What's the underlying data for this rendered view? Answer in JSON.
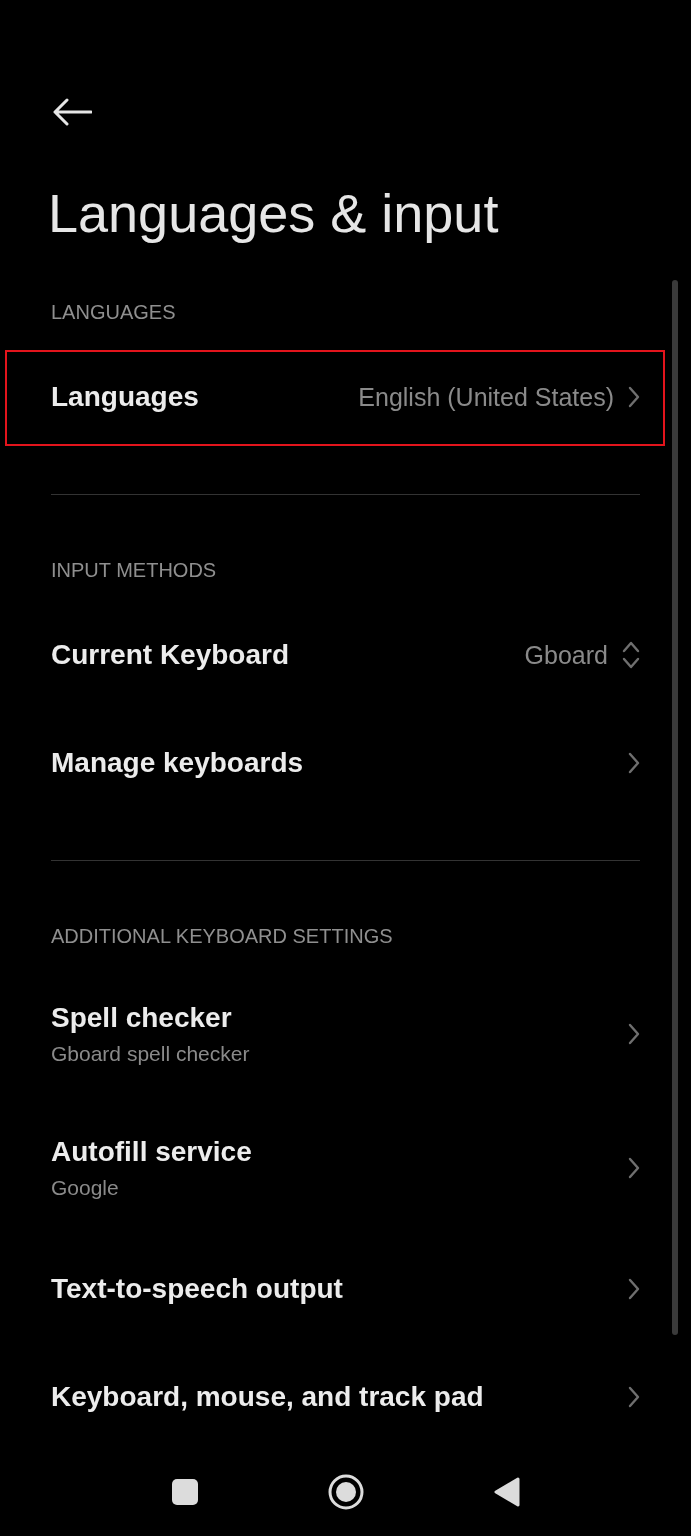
{
  "title": "Languages & input",
  "sections": [
    {
      "header": "LANGUAGES",
      "items": [
        {
          "kind": "link",
          "title": "Languages",
          "value": "English (United States)",
          "highlighted": true
        }
      ]
    },
    {
      "header": "INPUT METHODS",
      "items": [
        {
          "kind": "picker",
          "title": "Current Keyboard",
          "value": "Gboard",
          "highlighted": false
        },
        {
          "kind": "link",
          "title": "Manage keyboards",
          "highlighted": false
        }
      ]
    },
    {
      "header": "ADDITIONAL KEYBOARD SETTINGS",
      "items": [
        {
          "kind": "link",
          "title": "Spell checker",
          "subtitle": "Gboard spell checker",
          "highlighted": false
        },
        {
          "kind": "link",
          "title": "Autofill service",
          "subtitle": "Google",
          "highlighted": false
        },
        {
          "kind": "link",
          "title": "Text-to-speech output",
          "highlighted": false
        },
        {
          "kind": "link",
          "title": "Keyboard, mouse, and track pad",
          "highlighted": false
        }
      ]
    }
  ]
}
